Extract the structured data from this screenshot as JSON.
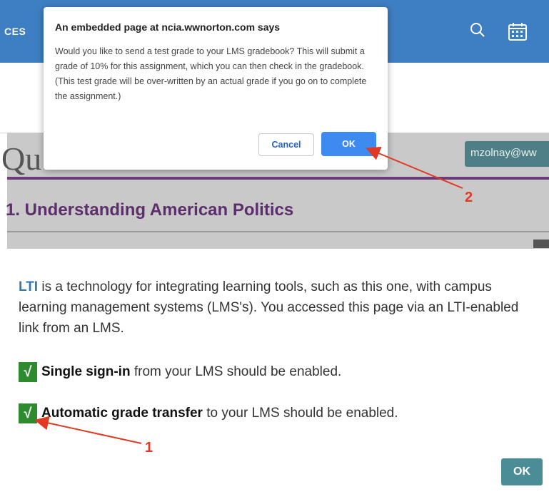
{
  "header": {
    "brand_fragment": "CES",
    "search_icon": "search-icon",
    "calendar_icon": "calendar-icon",
    "bg_color": "#3e7ec2"
  },
  "quiz": {
    "title_fragment": "Qu",
    "user_fragment": "mzolnay@ww",
    "section_heading": "1. Understanding American Politics"
  },
  "dialog": {
    "title": "An embedded page at ncia.wwnorton.com says",
    "body": "Would you like to send a test grade to your LMS gradebook? This will submit a grade of 10% for this assignment, which you can then check in the gradebook. (This test grade will be over-written by an actual grade if you go on to complete the assignment.)",
    "cancel_label": "Cancel",
    "ok_label": "OK"
  },
  "lti": {
    "term": "LTI",
    "intro_rest": " is a technology for integrating learning tools, such as this one, with campus learning management systems (LMS's). You accessed this page via an LTI-enabled link from an LMS.",
    "check_glyph": "√",
    "features": [
      {
        "strong": "Single sign-in",
        "rest": " from your LMS should be enabled."
      },
      {
        "strong": "Automatic grade transfer",
        "rest": " to your LMS should be enabled."
      }
    ],
    "ok_label": "OK"
  },
  "annotations": {
    "label_1": "1",
    "label_2": "2",
    "color": "#e03a22"
  }
}
